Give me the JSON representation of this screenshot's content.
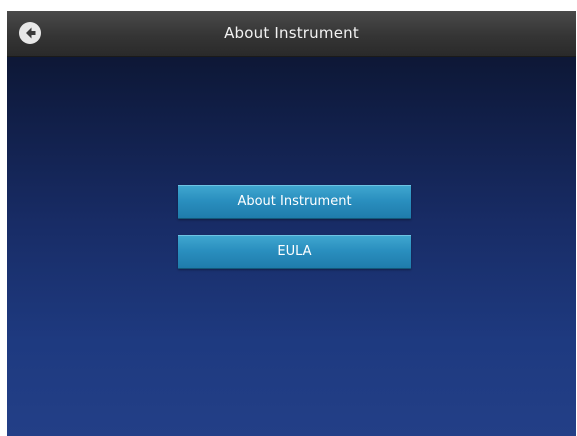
{
  "header": {
    "title": "About Instrument",
    "back_icon": "back-arrow-icon"
  },
  "menu": {
    "items": [
      {
        "label": "About Instrument"
      },
      {
        "label": "EULA"
      }
    ]
  },
  "colors": {
    "header_bg": "#353535",
    "screen_bg_top": "#0b1228",
    "screen_bg_bottom": "#233f87",
    "button_accent": "#2a8fbf"
  }
}
